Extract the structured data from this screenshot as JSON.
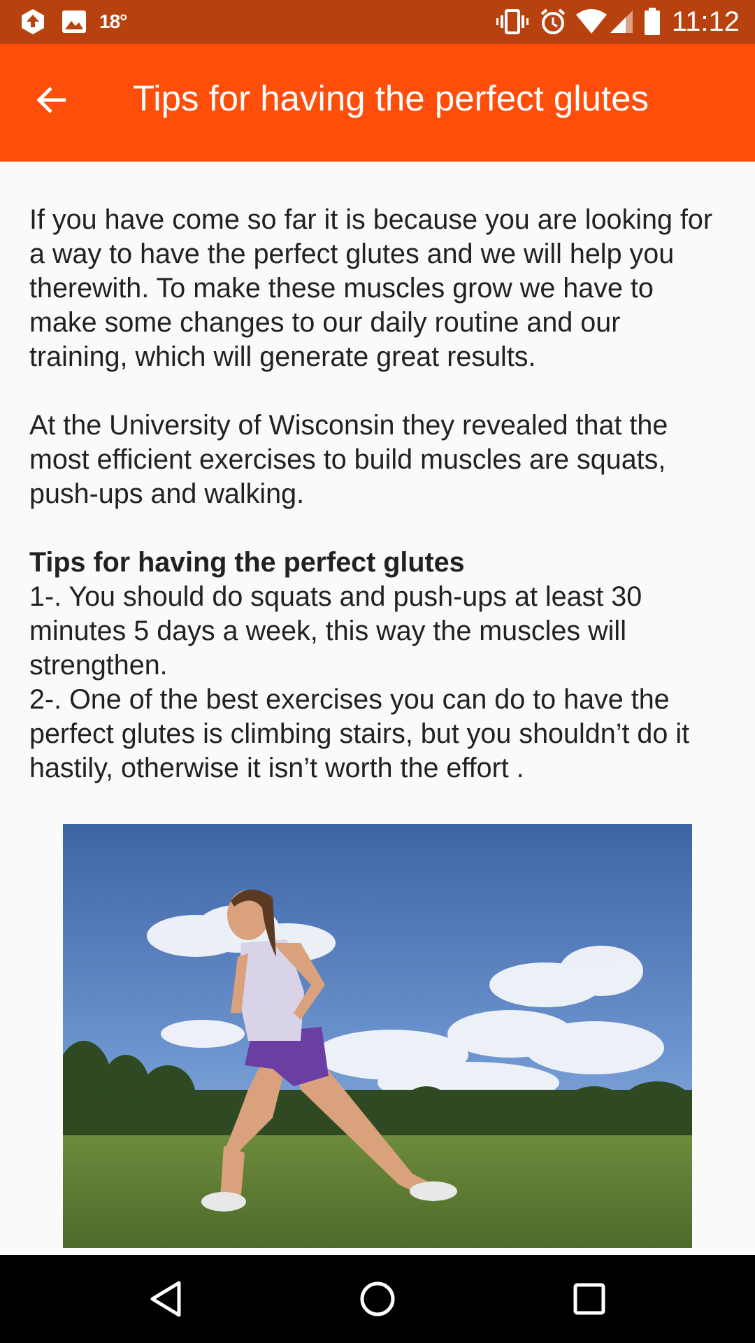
{
  "status_bar": {
    "temperature": "18°",
    "time": "11:12",
    "icons": [
      "upload-badge-icon",
      "image-icon",
      "vibrate-icon",
      "alarm-icon",
      "wifi-icon",
      "signal-icon",
      "battery-icon"
    ]
  },
  "app_bar": {
    "title": "Tips for having the perfect glutes",
    "back_icon": "arrow-back-icon"
  },
  "article": {
    "para1": "If you have come so far it is because you are looking for a way to have the perfect glutes and we will help you therewith. To make these muscles grow we have to make some changes to our daily routine and our training, which will generate great results.",
    "para2": "At the University of Wisconsin they revealed that the most efficient exercises to build muscles are squats, push-ups and walking.",
    "tips_heading": "Tips for having the perfect glutes",
    "tip1": "1-. You should do squats and push-ups at least 30 minutes 5 days a week, this way the muscles will strengthen.",
    "tip2": "2-. One of the best exercises you can do to have the perfect glutes is climbing stairs, but you shouldn’t do it hastily, otherwise it isn’t worth the effort ."
  },
  "nav_bar": {
    "icons": [
      "back-triangle-icon",
      "home-circle-icon",
      "recents-square-icon"
    ]
  },
  "colors": {
    "status_bar": "#b8420f",
    "app_bar": "#ff4e0a",
    "background": "#fafafa",
    "text": "#212121"
  }
}
